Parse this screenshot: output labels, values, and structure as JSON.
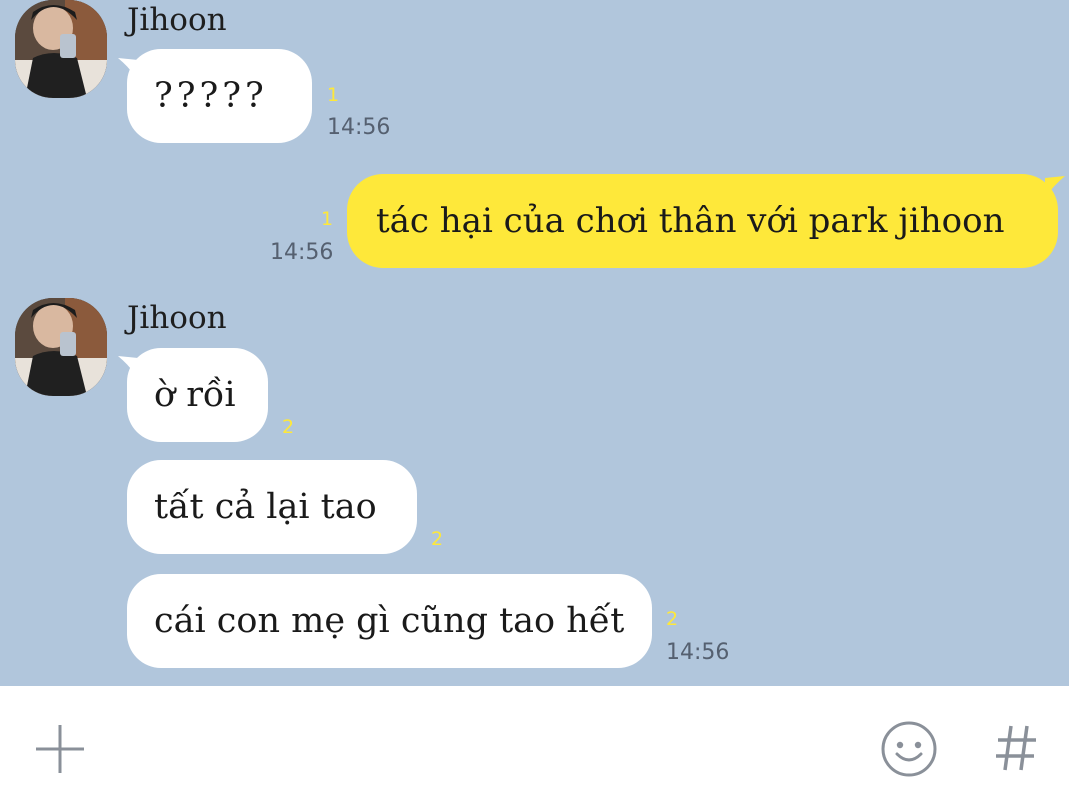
{
  "messages": [
    {
      "sender": "Jihoon",
      "text": "?????",
      "unread": "1",
      "time": "14:56"
    },
    {
      "text": "tác hại của chơi thân với park jihoon",
      "unread": "1",
      "time": "14:56"
    },
    {
      "sender": "Jihoon",
      "text": "ờ rồi",
      "unread": "2"
    },
    {
      "text": "tất cả lại tao",
      "unread": "2"
    },
    {
      "text": "cái con mẹ gì cũng tao hết",
      "unread": "2",
      "time": "14:56"
    }
  ],
  "input_bar": {
    "icons": [
      "plus-icon",
      "emoji-icon",
      "hashtag-icon"
    ]
  },
  "colors": {
    "chat_background": "#b1c6dc",
    "outgoing_bubble": "#fee83a",
    "incoming_bubble": "#ffffff",
    "unread_count": "#fee83a",
    "timestamp": "#556070"
  }
}
